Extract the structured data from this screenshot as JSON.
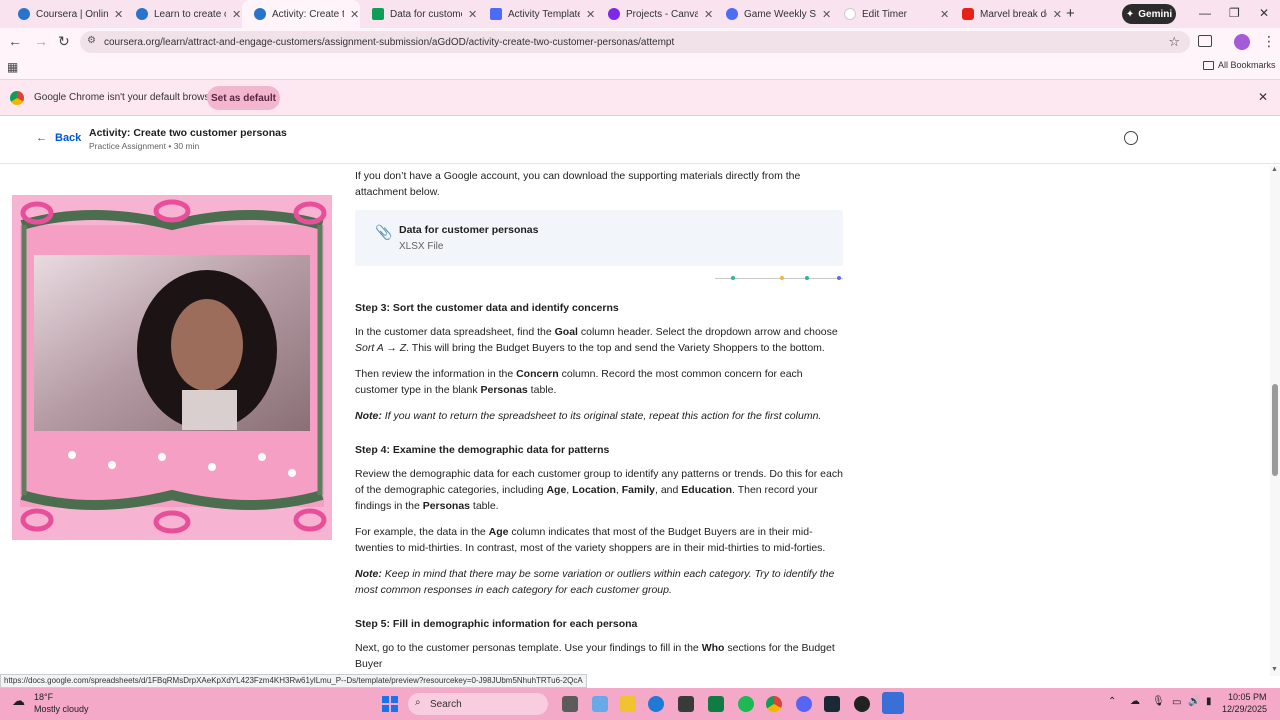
{
  "browser": {
    "tabs": [
      {
        "title": "Coursera | Online C",
        "color": "#2a73cc"
      },
      {
        "title": "Learn to create cust",
        "color": "#2a73cc"
      },
      {
        "title": "Activity: Create two",
        "color": "#2a73cc"
      },
      {
        "title": "Data for customer p",
        "color": "#0f9d58"
      },
      {
        "title": "Activity Template: C",
        "color": "#4a6cf7"
      },
      {
        "title": "Projects - Canva",
        "color": "#7d2ae8"
      },
      {
        "title": "Game Weekly Sche",
        "color": "#4a6cf7"
      },
      {
        "title": "Edit Timer",
        "color": "#ffffff"
      },
      {
        "title": "Marvel break down",
        "color": "#e62117"
      }
    ],
    "new_tab_label": "+",
    "gemini_label": "Gemini",
    "url": "coursera.org/learn/attract-and-engage-customers/assignment-submission/aGdOD/activity-create-two-customer-personas/attempt",
    "all_bookmarks_label": "All Bookmarks",
    "infobar_text": "Google Chrome isn't your default browser",
    "set_default_label": "Set as default"
  },
  "header": {
    "back_label": "Back",
    "title": "Activity: Create two customer personas",
    "subtitle": "Practice Assignment • 30 min"
  },
  "content": {
    "intro": "If you don’t have a Google account, you can download the supporting materials directly from the attachment below.",
    "attachment_title": "Data for customer personas",
    "attachment_type": "XLSX File",
    "step3_heading": "Step 3: Sort the customer data and identify concerns",
    "step3_p1_a": "In the customer data spreadsheet, find the ",
    "step3_p1_b": "Goal",
    "step3_p1_c": " column header. Select the dropdown arrow and choose ",
    "step3_p1_d": "Sort A → Z",
    "step3_p1_e": ". This will bring the Budget Buyers to the top and send the Variety Shoppers to the bottom.",
    "step3_p2_a": "Then review the information in the ",
    "step3_p2_b": "Concern",
    "step3_p2_c": " column. Record the most common concern for each customer type in the blank ",
    "step3_p2_d": "Personas",
    "step3_p2_e": " table.",
    "note1_label": "Note:",
    "note1_text": " If you want to return the spreadsheet to its original state, repeat this action for the first column.",
    "step4_heading": "Step 4: Examine the demographic data for patterns",
    "step4_p1_a": "Review the demographic data for each customer group to identify any patterns or trends. Do this for each of the demographic categories, including ",
    "step4_p1_age": "Age",
    "step4_p1_sep1": ", ",
    "step4_p1_loc": "Location",
    "step4_p1_sep2": ", ",
    "step4_p1_fam": "Family",
    "step4_p1_and": ", and ",
    "step4_p1_edu": "Education",
    "step4_p1_b": ". Then record your findings in the ",
    "step4_p1_per": "Personas",
    "step4_p1_c": " table.",
    "step4_p2_a": "For example, the data in the ",
    "step4_p2_b": "Age",
    "step4_p2_c": " column indicates that most of the Budget Buyers are in their mid-twenties to mid-thirties. In contrast, most of the variety shoppers are in their mid-thirties to mid-forties.",
    "note2_label": "Note:",
    "note2_text": " Keep in mind that there may be some variation or outliers within each category. Try to identify the most common responses in each category for each customer group.",
    "step5_heading": "Step 5: Fill in demographic information for each persona",
    "step5_p1_a": "Next, go to the customer personas template. Use your findings to fill in the ",
    "step5_p1_b": "Who",
    "step5_p1_c": " sections for the Budget Buyer"
  },
  "status_link": "https://docs.google.com/spreadsheets/d/1FBqRMsDrpXAeKpXdYL423Fzm4KH3Rw61ylLmu_P--Ds/template/preview?resourcekey=0-J98JUbm5NhuhTRTu6-2QcA",
  "taskbar": {
    "weather_temp": "18°F",
    "weather_desc": "Mostly cloudy",
    "search_label": "Search",
    "time": "10:05 PM",
    "date": "12/29/2025"
  },
  "colors": {
    "accent": "#0056d2",
    "taskbar": "#f4a9c8",
    "infobar": "#fde7f0"
  }
}
